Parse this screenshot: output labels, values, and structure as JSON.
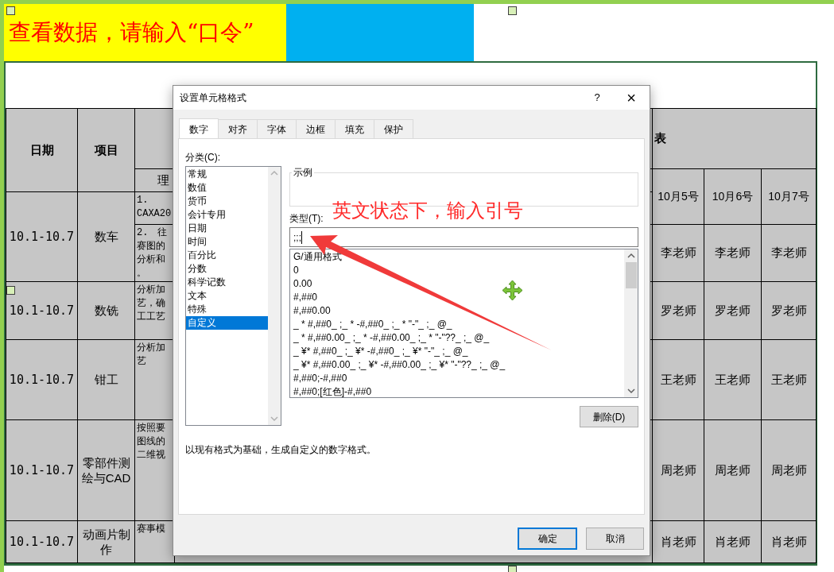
{
  "banner": {
    "prompt": "查看数据，请输入“口令”"
  },
  "sheet": {
    "header_date": "日期",
    "header_item": "项目",
    "header_theory": "理",
    "header_schedule": "表",
    "dates": [
      "10月5号",
      "10月6号",
      "10月7号"
    ],
    "rows": [
      {
        "date": "10.1-10.7",
        "item": "数车",
        "content": [
          [
            "1.",
            "CAXA20"
          ],
          [
            "2.　往",
            "赛图的",
            "分析和",
            "。"
          ]
        ],
        "teachers": [
          "李老师",
          "李老师",
          "李老师"
        ]
      },
      {
        "date": "10.1-10.7",
        "item": "数铣",
        "content": [
          [
            "分析加",
            "艺，确",
            "工工艺"
          ]
        ],
        "teachers": [
          "罗老师",
          "罗老师",
          "罗老师"
        ]
      },
      {
        "date": "10.1-10.7",
        "item": "钳工",
        "content": [
          [
            "分析加",
            "艺"
          ]
        ],
        "teachers": [
          "王老师",
          "王老师",
          "王老师"
        ]
      },
      {
        "date": "10.1-10.7",
        "item": "零部件测绘与CAD",
        "content": [
          [
            "按照要",
            "图线的",
            "二维视"
          ]
        ],
        "teachers": [
          "周老师",
          "周老师",
          "周老师"
        ]
      },
      {
        "date": "10.1-10.7",
        "item": "动画片制作",
        "content": [
          [
            "赛事模"
          ]
        ],
        "teachers": [
          "肖老师",
          "肖老师",
          "肖老师"
        ]
      }
    ]
  },
  "dialog": {
    "title": "设置单元格格式",
    "help": "?",
    "close": "×",
    "tabs": [
      {
        "label": "数字",
        "selected": true
      },
      {
        "label": "对齐",
        "selected": false
      },
      {
        "label": "字体",
        "selected": false
      },
      {
        "label": "边框",
        "selected": false
      },
      {
        "label": "填充",
        "selected": false
      },
      {
        "label": "保护",
        "selected": false
      }
    ],
    "category_label": "分类(C):",
    "categories": [
      {
        "label": "常规",
        "selected": false
      },
      {
        "label": "数值",
        "selected": false
      },
      {
        "label": "货币",
        "selected": false
      },
      {
        "label": "会计专用",
        "selected": false
      },
      {
        "label": "日期",
        "selected": false
      },
      {
        "label": "时间",
        "selected": false
      },
      {
        "label": "百分比",
        "selected": false
      },
      {
        "label": "分数",
        "selected": false
      },
      {
        "label": "科学记数",
        "selected": false
      },
      {
        "label": "文本",
        "selected": false
      },
      {
        "label": "特殊",
        "selected": false
      },
      {
        "label": "自定义",
        "selected": true
      }
    ],
    "sample_label": "示例",
    "type_label": "类型(T):",
    "type_value": ";;;",
    "formats": [
      "G/通用格式",
      "0",
      "0.00",
      "#,##0",
      "#,##0.00",
      "_ * #,##0_ ;_ * -#,##0_ ;_ * \"-\"_ ;_ @_",
      "_ * #,##0.00_ ;_ * -#,##0.00_ ;_ * \"-\"??_ ;_ @_",
      "_ ¥* #,##0_ ;_ ¥* -#,##0_ ;_ ¥* \"-\"_ ;_ @_",
      "_ ¥* #,##0.00_ ;_ ¥* -#,##0.00_ ;_ ¥* \"-\"??_ ;_ @_",
      "#,##0;-#,##0",
      "#,##0;[红色]-#,##0"
    ],
    "delete_button": "删除(D)",
    "description": "以现有格式为基础，生成自定义的数字格式。",
    "buttons": [
      {
        "label": "确定",
        "focused": true
      },
      {
        "label": "取消",
        "focused": false
      }
    ]
  },
  "annotation": {
    "text": "英文状态下，输入引号"
  }
}
